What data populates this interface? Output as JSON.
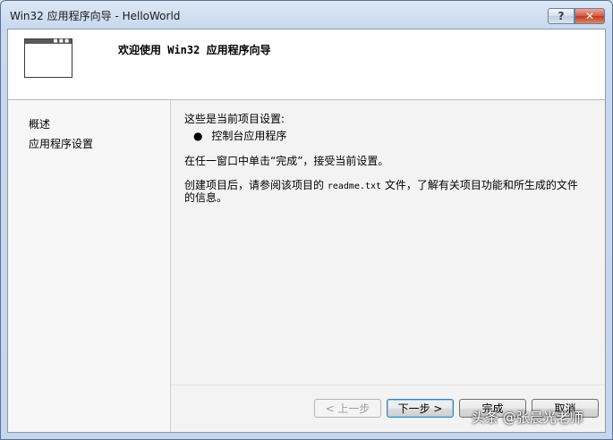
{
  "window": {
    "title": "Win32 应用程序向导 - HelloWorld",
    "help_label": "?",
    "close_label": "✕"
  },
  "header": {
    "title": "欢迎使用 Win32 应用程序向导"
  },
  "nav": {
    "items": [
      {
        "label": "概述"
      },
      {
        "label": "应用程序设置"
      }
    ]
  },
  "content": {
    "current_settings_label": "这些是当前项目设置:",
    "bullet_item": "控制台应用程序",
    "instruction": "在任一窗口中单击“完成”，接受当前设置。",
    "readme_prefix": "创建项目后，请参阅该项目的",
    "readme_file": "readme.txt",
    "readme_suffix": "文件，了解有关项目功能和所生成的文件",
    "readme_line2": "的信息。"
  },
  "buttons": {
    "prev": "< 上一步",
    "next": "下一步 >",
    "finish": "完成",
    "cancel": "取消"
  },
  "watermark": "头条 @张晨光老师"
}
